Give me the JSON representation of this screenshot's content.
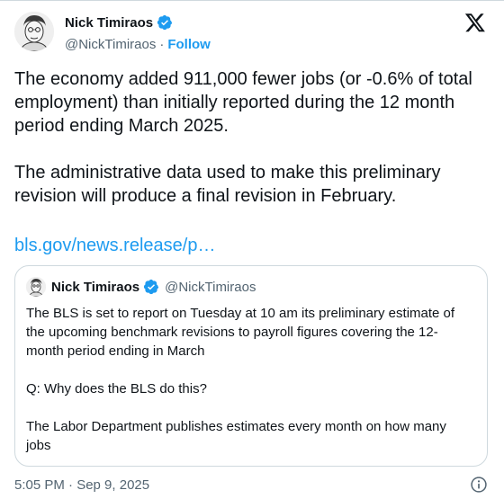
{
  "author": {
    "name": "Nick Timiraos",
    "handle": "@NickTimiraos",
    "separator": "·",
    "follow_label": "Follow"
  },
  "tweet": {
    "paragraph_1": "The economy added 911,000 fewer jobs (or -0.6% of total employment) than initially reported during the 12 month period ending March 2025.",
    "paragraph_2": "The administrative data used to make this preliminary revision will produce a final revision in February.",
    "link_text": "bls.gov/news.release/p…"
  },
  "quoted_tweet": {
    "name": "Nick Timiraos",
    "handle": "@NickTimiraos",
    "paragraph_1": "The BLS is set to report on Tuesday at 10 am its preliminary estimate of the upcoming benchmark revisions to payroll figures covering the 12-month period ending in March",
    "paragraph_2": "Q: Why does the BLS do this?",
    "paragraph_3": "The Labor Department publishes estimates every month on how many jobs"
  },
  "footer": {
    "timestamp": "5:05 PM · Sep 9, 2025"
  },
  "icons": {
    "logo": "x-logo-icon",
    "verified": "verified-badge-icon",
    "info": "info-icon"
  },
  "colors": {
    "accent": "#1d9bf0",
    "text": "#0f1419",
    "secondary": "#536471",
    "border": "#cfd9de"
  }
}
